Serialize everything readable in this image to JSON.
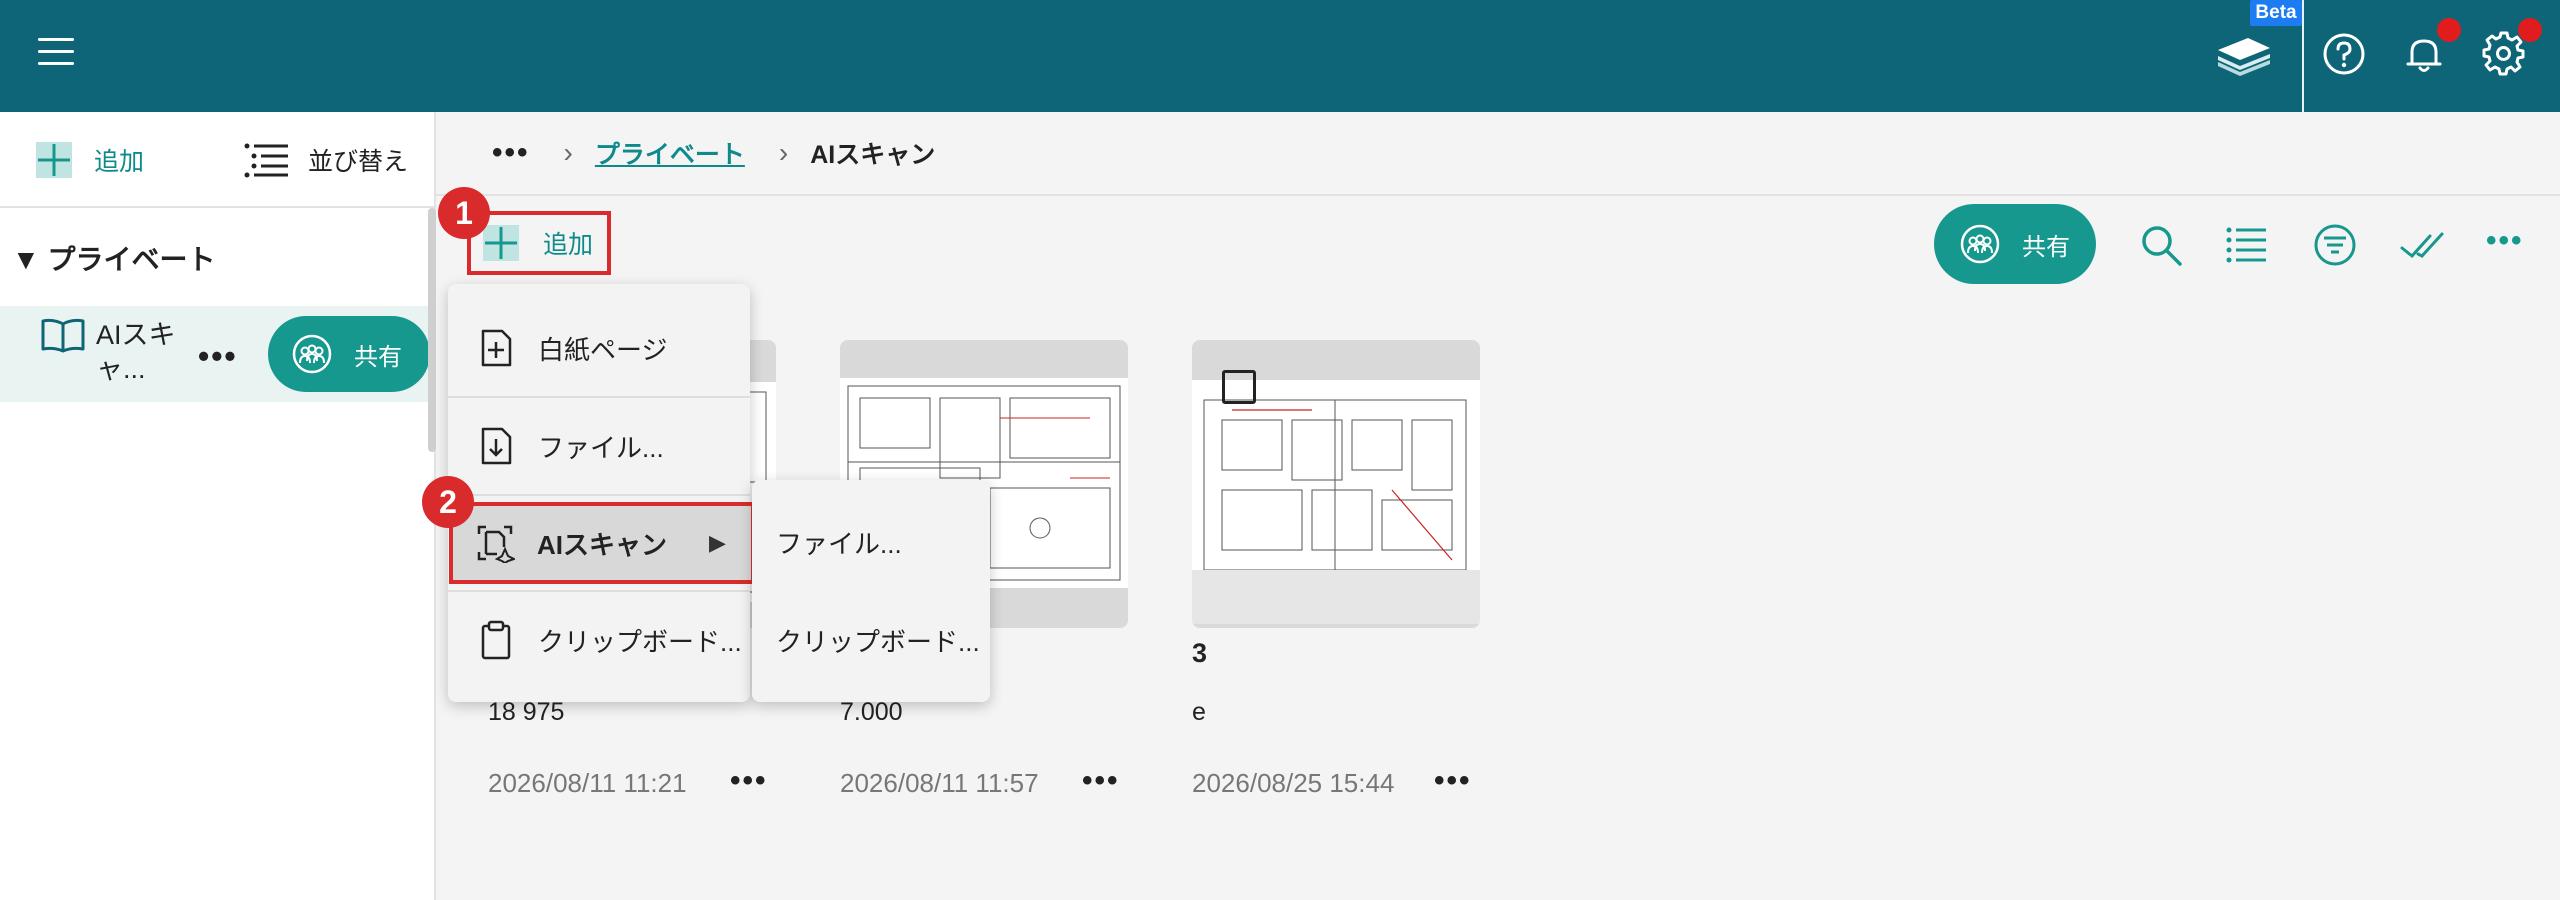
{
  "header": {
    "beta_label": "Beta",
    "icons": [
      "menu-icon",
      "app-stack-icon",
      "help-icon",
      "bell-icon",
      "gear-icon"
    ],
    "colors": {
      "bar": "#0e6577",
      "notification_dot": "#e01c1c"
    }
  },
  "sidebar": {
    "add_label": "追加",
    "sort_label": "並び替え",
    "section_label": "▼ プライベート",
    "item": {
      "label": "AIスキャ...",
      "share_label": "共有"
    }
  },
  "breadcrumb": {
    "more": "•••",
    "parent": "プライベート",
    "current": "AIスキャン"
  },
  "toolbar": {
    "add_label": "追加",
    "share_label": "共有",
    "step1": "1",
    "step2": "2"
  },
  "add_menu": {
    "items": [
      {
        "label": "白紙ページ",
        "icon": "new-page-icon"
      },
      {
        "label": "ファイル...",
        "icon": "file-download-icon"
      },
      {
        "label": "AIスキャン",
        "icon": "ai-scan-icon"
      },
      {
        "label": "クリップボード...",
        "icon": "clipboard-icon"
      }
    ],
    "submenu": [
      {
        "label": "ファイル..."
      },
      {
        "label": "クリップボード..."
      }
    ]
  },
  "cards": [
    {
      "title": "",
      "subtitle": "18 975",
      "date": "2026/08/11 11:21",
      "more": "•••"
    },
    {
      "title": "",
      "subtitle": "7.000",
      "date": "2026/08/11 11:57",
      "more": "•••"
    },
    {
      "title": "3",
      "subtitle": "e",
      "date": "2026/08/25 15:44",
      "more": "•••"
    }
  ],
  "colors": {
    "accent": "#17988f",
    "link": "#0e8a8a",
    "highlight": "#d92b2b"
  }
}
